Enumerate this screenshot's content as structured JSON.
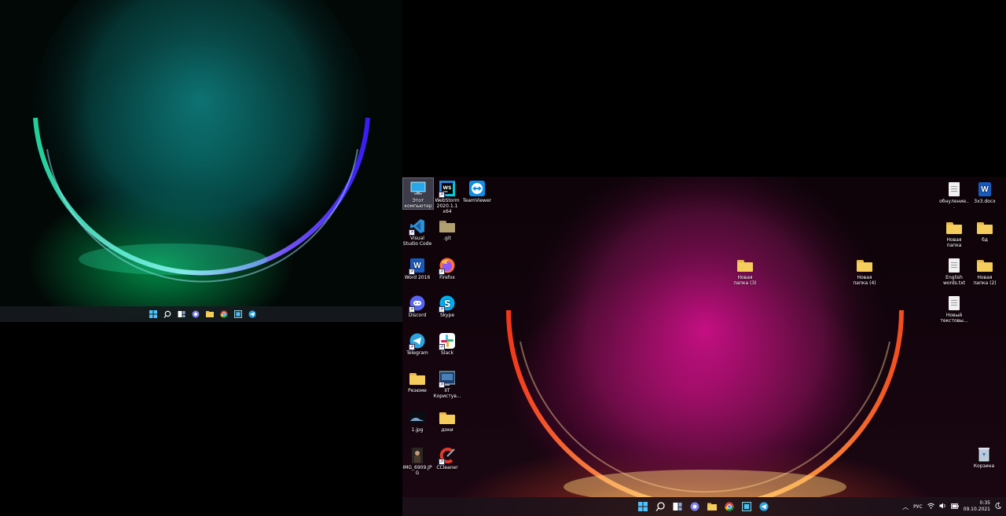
{
  "left_monitor": {
    "taskbar_icons": [
      "windows-start-icon",
      "search-icon",
      "task-view-icon",
      "teams-chat-icon",
      "file-explorer-icon",
      "chrome-icon",
      "screen-capture-icon",
      "telegram-icon"
    ]
  },
  "right_monitor": {
    "desktop_icons": {
      "this_pc": "Этот компьютер",
      "webstorm": "WebStorm 2020.1.1 x64",
      "teamviewer": "TeamViewer",
      "vscode": "Visual Studio Code",
      "git": ".git",
      "word": "Word 2016",
      "firefox": "Firefox",
      "discord": "Discord",
      "skype": "Skype",
      "telegram": "Telegram",
      "slack": "Slack",
      "resume": "Резюме",
      "iit": "IIT Користув...",
      "jpg1": "1.jpg",
      "docs": "доки",
      "img6909": "IMG_6909.JPG",
      "ccleaner": "CCleaner",
      "new_folder_3": "Новая папка (3)",
      "new_folder_4": "Новая папка (4)",
      "obnulenie": "обнуление...",
      "docx3x3": "3x3.docx",
      "new_folder": "Новая папка",
      "bd": "бд",
      "english_words": "English words.txt",
      "new_folder_2": "Новая папка (2)",
      "new_text": "Новый текстовы...",
      "recycle_bin": "Корзина"
    },
    "taskbar": {
      "lang": "РУС",
      "time": "0:35",
      "date": "09.10.2021"
    }
  },
  "colors": {
    "word_blue": "#185abd",
    "folder_yellow": "#f5cd5c",
    "vscode_blue": "#2b8fd6",
    "discord": "#5865f2",
    "skype": "#00aff0",
    "telegram": "#2aa3de"
  }
}
